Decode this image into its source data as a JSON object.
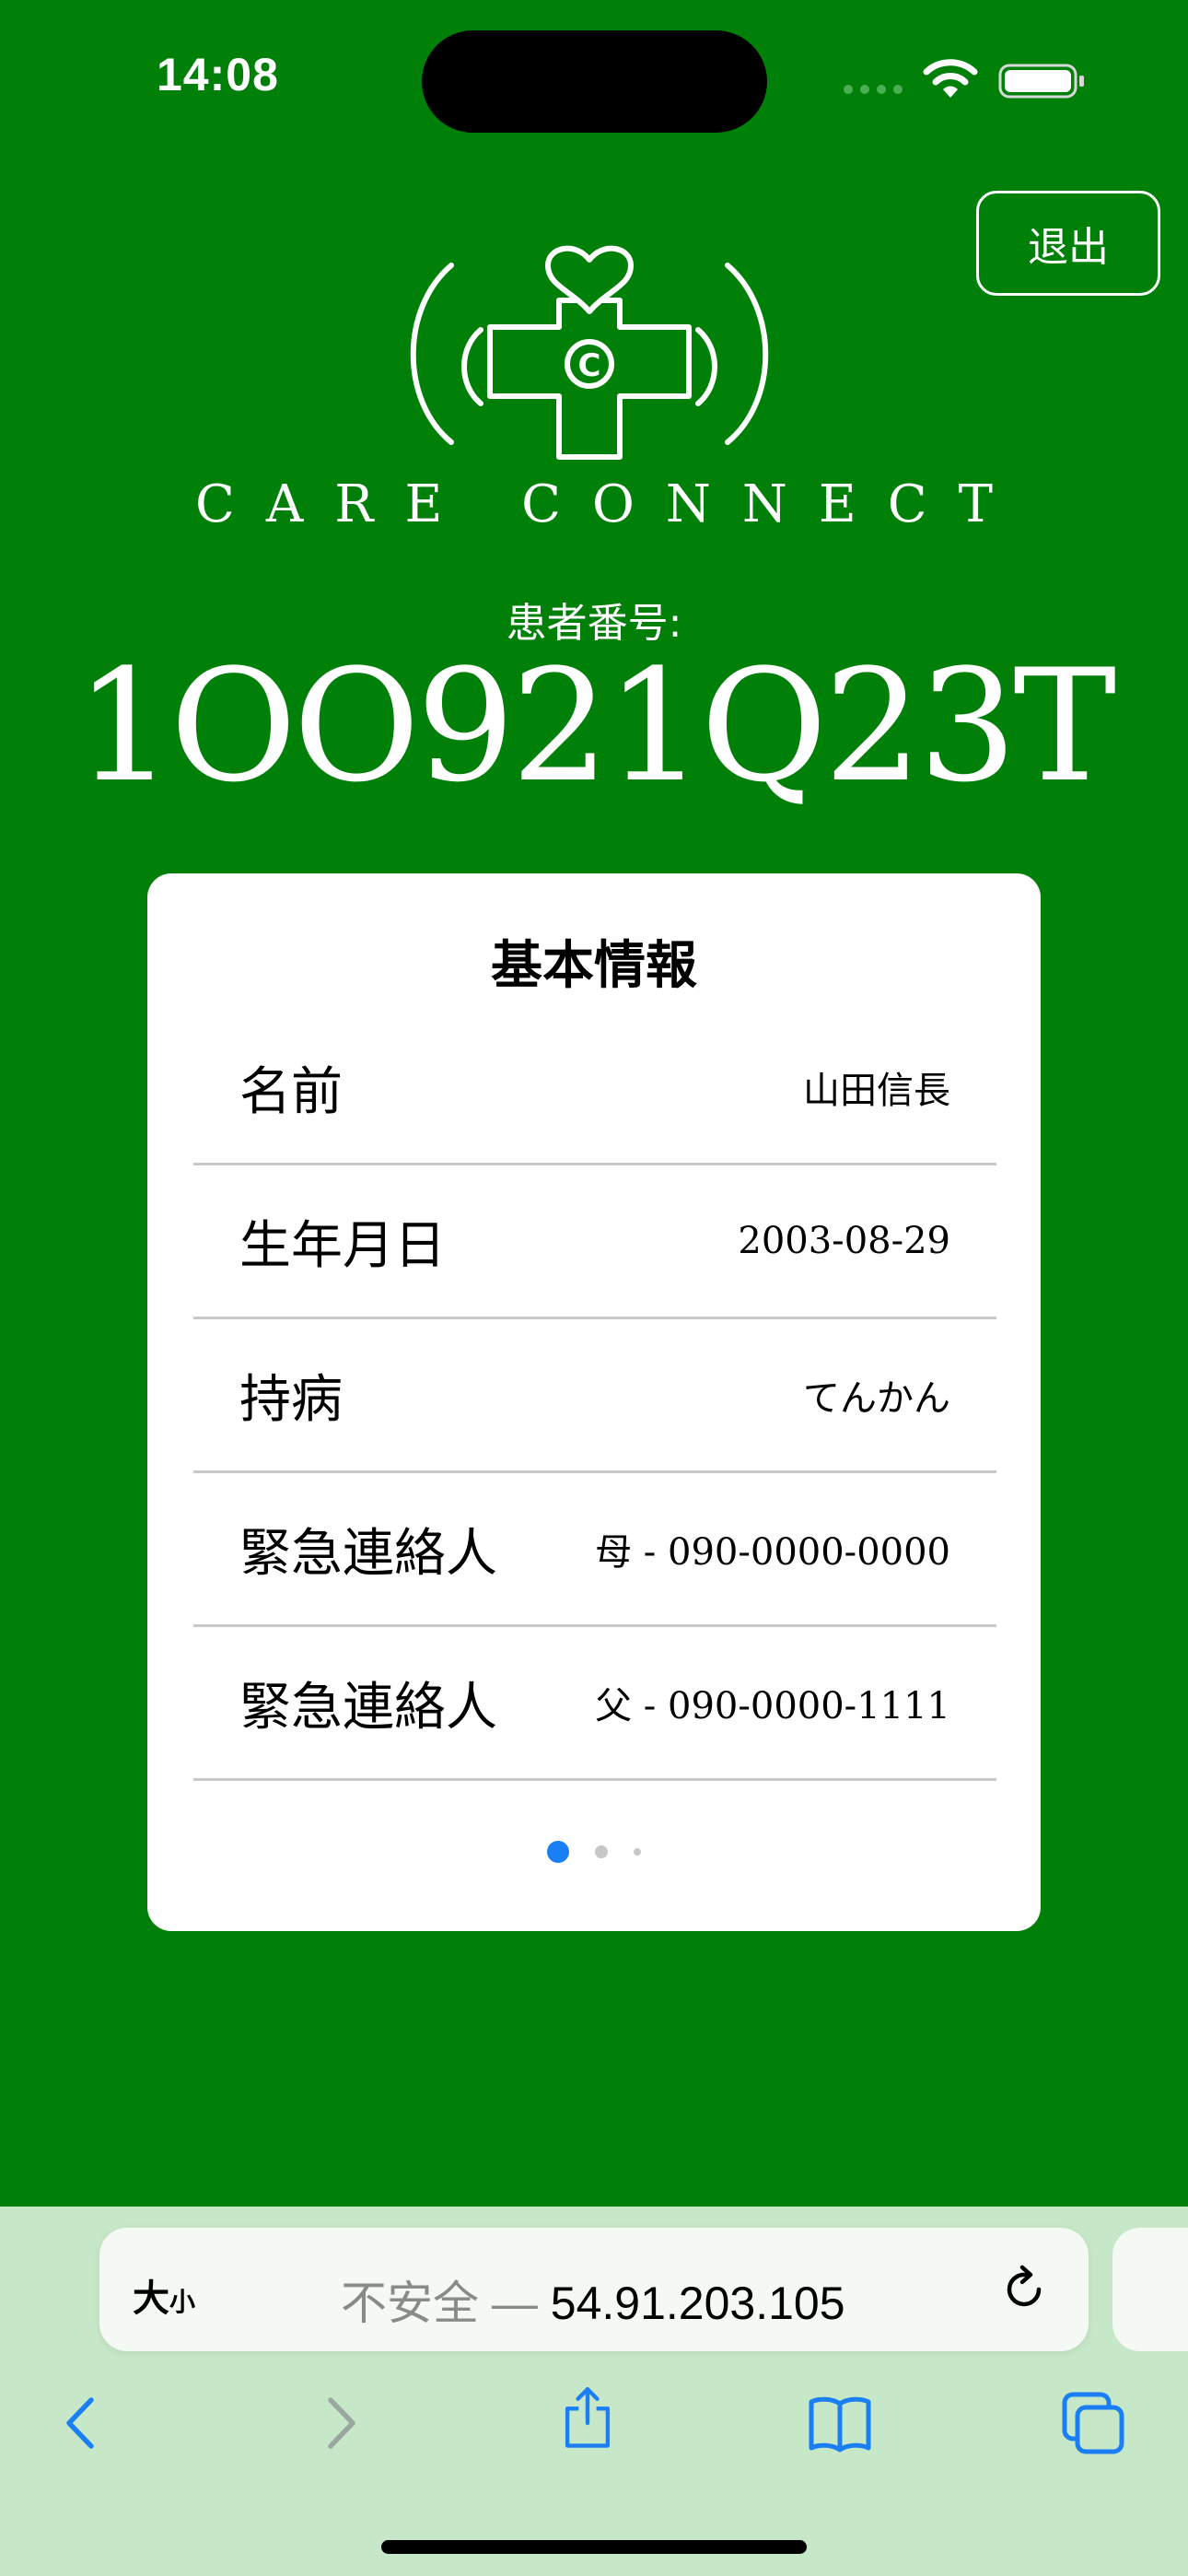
{
  "status_bar": {
    "time": "14:08"
  },
  "header": {
    "exit_label": "退出"
  },
  "logo": {
    "text": "CARE CONNECT"
  },
  "patient": {
    "label": "患者番号:",
    "number": "1OO921Q23T"
  },
  "card": {
    "title": "基本情報",
    "rows": [
      {
        "label": "名前",
        "value": "山田信長"
      },
      {
        "label": "生年月日",
        "value": "2003-08-29"
      },
      {
        "label": "持病",
        "value": "てんかん"
      },
      {
        "label": "緊急連絡人",
        "value": "母 - 090-0000-0000"
      },
      {
        "label": "緊急連絡人",
        "value": "父 - 090-0000-1111"
      }
    ],
    "page_count": 3,
    "current_page": 1
  },
  "browser": {
    "text_size_label": "大",
    "text_size_small": "小",
    "insecure_label": "不安全 — ",
    "address": "54.91.203.105"
  },
  "colors": {
    "background": "#008009",
    "accent": "#1a7ef5",
    "browser_bar": "#c7e8c8"
  }
}
